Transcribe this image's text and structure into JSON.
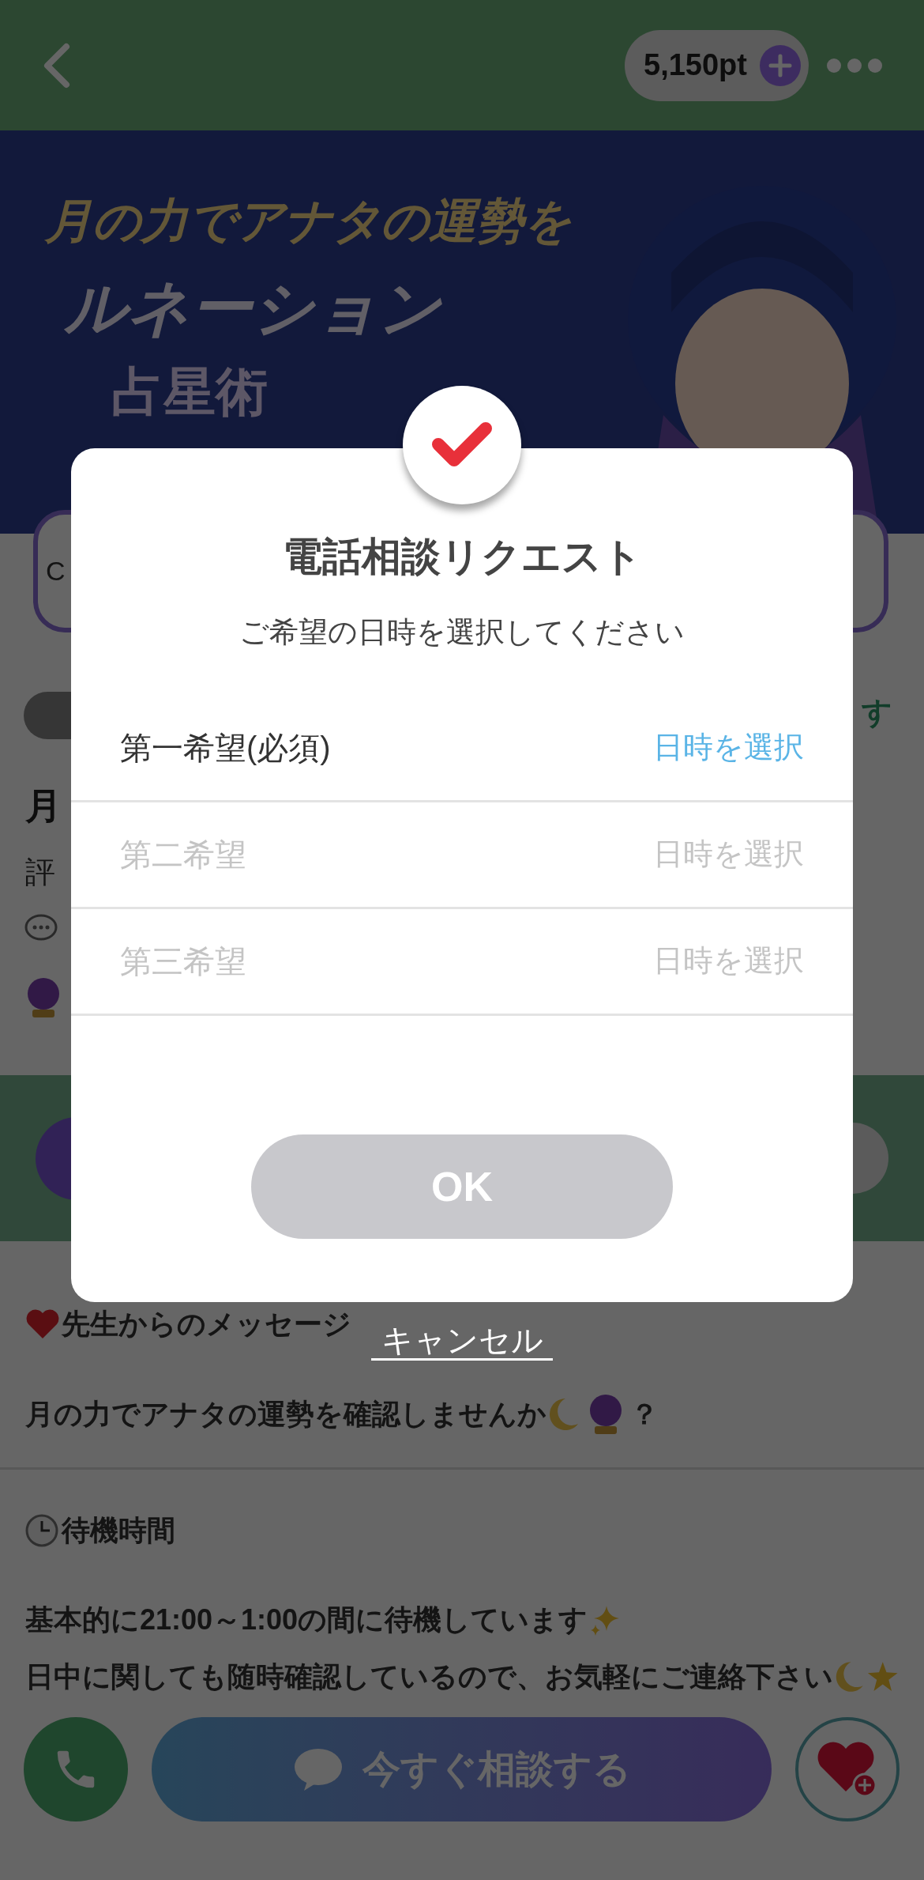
{
  "top_bar": {
    "points": "5,150pt"
  },
  "banner": {
    "lines": [
      "月の力でアナタの運勢を",
      "ルネーション",
      "占星術"
    ]
  },
  "background": {
    "card_text": "C",
    "badge_text": "す",
    "title_fragment": "月",
    "rating_fragment": "評"
  },
  "message_section": {
    "heading": "先生からのメッセージ",
    "body": "月の力でアナタの運勢を確認しませんか",
    "tail": "？"
  },
  "waiting_section": {
    "heading": "待機時間",
    "lines": [
      "基本的に21:00～1:00の間に待機しています",
      "日中に関しても随時確認しているので、お気軽にご連絡下さい"
    ]
  },
  "bottom_bar": {
    "consult_button": "今すぐ相談する"
  },
  "dialog": {
    "title": "電話相談リクエスト",
    "subtitle": "ご希望の日時を選択してください",
    "rows": [
      {
        "label": "第一希望(必須)",
        "action": "日時を選択",
        "disabled": false
      },
      {
        "label": "第二希望",
        "action": "日時を選択",
        "disabled": true
      },
      {
        "label": "第三希望",
        "action": "日時を選択",
        "disabled": true
      }
    ],
    "ok": {
      "label": "OK",
      "disabled": true
    },
    "cancel": "キャンセル"
  }
}
